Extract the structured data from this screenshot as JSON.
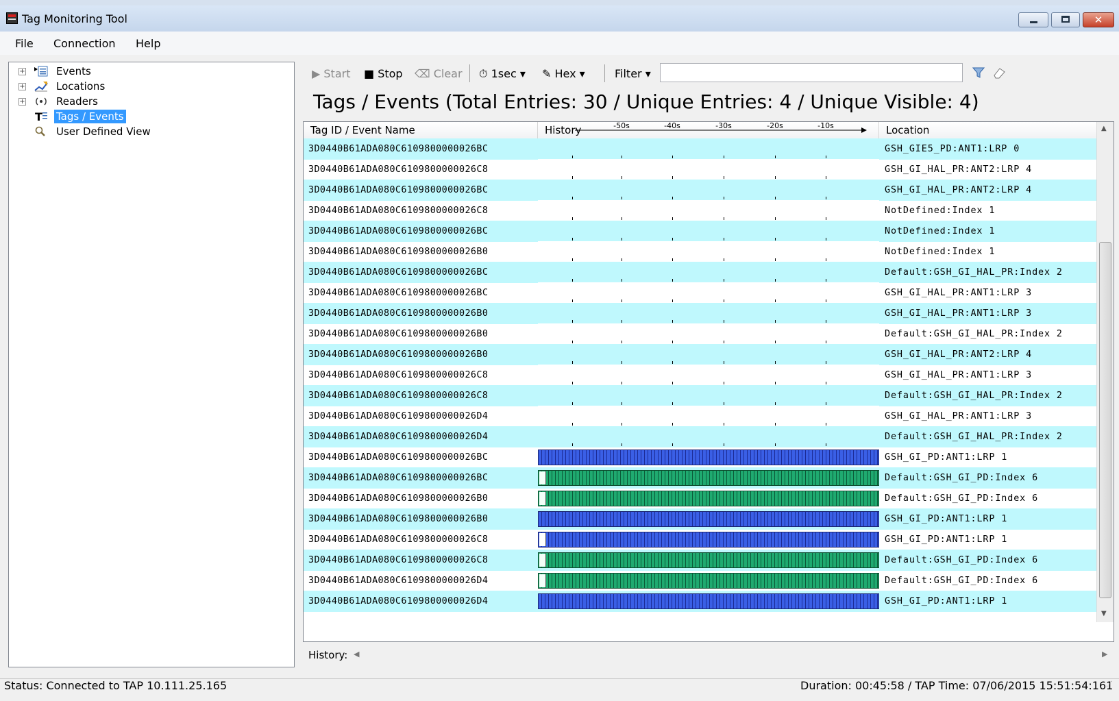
{
  "window": {
    "title": "Tag Monitoring Tool",
    "close_glyph": "✕"
  },
  "menu": [
    "File",
    "Connection",
    "Help"
  ],
  "tree": [
    {
      "label": "Events",
      "icon": "events-list-icon",
      "expand": "+"
    },
    {
      "label": "Locations",
      "icon": "locations-map-icon",
      "expand": "+"
    },
    {
      "label": "Readers",
      "icon": "reader-antenna-icon",
      "expand": "+"
    },
    {
      "label": "Tags / Events",
      "icon": "tag-text-icon",
      "selected": true
    },
    {
      "label": "User Defined View",
      "icon": "magnifier-icon"
    }
  ],
  "toolbar": {
    "start": "Start",
    "stop": "Stop",
    "clear": "Clear",
    "interval": "1sec",
    "format": "Hex",
    "filter": "Filter",
    "filter_value": ""
  },
  "heading": "Tags / Events (Total Entries: 30 / Unique Entries: 4 / Unique Visible: 4)",
  "grid": {
    "columns": [
      "Tag ID / Event Name",
      "History",
      "Location"
    ],
    "history_ticks": [
      "-50s",
      "-40s",
      "-30s",
      "-20s",
      "-10s"
    ],
    "rows": [
      {
        "id": "3D0440B61ADA080C6109800000026BC",
        "location": "GSH_GIE5_PD:ANT1:LRP 0",
        "bars": ""
      },
      {
        "id": "3D0440B61ADA080C6109800000026C8",
        "location": "GSH_GI_HAL_PR:ANT2:LRP 4",
        "bars": ""
      },
      {
        "id": "3D0440B61ADA080C6109800000026BC",
        "location": "GSH_GI_HAL_PR:ANT2:LRP 4",
        "bars": ""
      },
      {
        "id": "3D0440B61ADA080C6109800000026C8",
        "location": "NotDefined:Index 1",
        "bars": ""
      },
      {
        "id": "3D0440B61ADA080C6109800000026BC",
        "location": "NotDefined:Index 1",
        "bars": ""
      },
      {
        "id": "3D0440B61ADA080C6109800000026B0",
        "location": "NotDefined:Index 1",
        "bars": ""
      },
      {
        "id": "3D0440B61ADA080C6109800000026BC",
        "location": "Default:GSH_GI_HAL_PR:Index 2",
        "bars": ""
      },
      {
        "id": "3D0440B61ADA080C6109800000026BC",
        "location": "GSH_GI_HAL_PR:ANT1:LRP 3",
        "bars": ""
      },
      {
        "id": "3D0440B61ADA080C6109800000026B0",
        "location": "GSH_GI_HAL_PR:ANT1:LRP 3",
        "bars": ""
      },
      {
        "id": "3D0440B61ADA080C6109800000026B0",
        "location": "Default:GSH_GI_HAL_PR:Index 2",
        "bars": ""
      },
      {
        "id": "3D0440B61ADA080C6109800000026B0",
        "location": "GSH_GI_HAL_PR:ANT2:LRP 4",
        "bars": ""
      },
      {
        "id": "3D0440B61ADA080C6109800000026C8",
        "location": "GSH_GI_HAL_PR:ANT1:LRP 3",
        "bars": ""
      },
      {
        "id": "3D0440B61ADA080C6109800000026C8",
        "location": "Default:GSH_GI_HAL_PR:Index 2",
        "bars": ""
      },
      {
        "id": "3D0440B61ADA080C6109800000026D4",
        "location": "GSH_GI_HAL_PR:ANT1:LRP 3",
        "bars": ""
      },
      {
        "id": "3D0440B61ADA080C6109800000026D4",
        "location": "Default:GSH_GI_HAL_PR:Index 2",
        "bars": ""
      },
      {
        "id": "3D0440B61ADA080C6109800000026BC",
        "location": "GSH_GI_PD:ANT1:LRP 1",
        "bars": "blue"
      },
      {
        "id": "3D0440B61ADA080C6109800000026BC",
        "location": "Default:GSH_GI_PD:Index 6",
        "bars": "green",
        "gap": true
      },
      {
        "id": "3D0440B61ADA080C6109800000026B0",
        "location": "Default:GSH_GI_PD:Index 6",
        "bars": "green",
        "gap": true
      },
      {
        "id": "3D0440B61ADA080C6109800000026B0",
        "location": "GSH_GI_PD:ANT1:LRP 1",
        "bars": "blue"
      },
      {
        "id": "3D0440B61ADA080C6109800000026C8",
        "location": "GSH_GI_PD:ANT1:LRP 1",
        "bars": "blue",
        "gap": true
      },
      {
        "id": "3D0440B61ADA080C6109800000026C8",
        "location": "Default:GSH_GI_PD:Index 6",
        "bars": "green",
        "gap": true
      },
      {
        "id": "3D0440B61ADA080C6109800000026D4",
        "location": "Default:GSH_GI_PD:Index 6",
        "bars": "green",
        "gap": true
      },
      {
        "id": "3D0440B61ADA080C6109800000026D4",
        "location": "GSH_GI_PD:ANT1:LRP 1",
        "bars": "blue"
      }
    ]
  },
  "history_label": "History:",
  "status": {
    "left": "Status: Connected to TAP 10.111.25.165",
    "right": "Duration: 00:45:58 /   TAP Time: 07/06/2015 15:51:54:161"
  },
  "colors": {
    "row_alt": "#bff8fd",
    "bar_blue": "#3a5fe6",
    "bar_green": "#1faa70",
    "selection": "#3399ff"
  }
}
